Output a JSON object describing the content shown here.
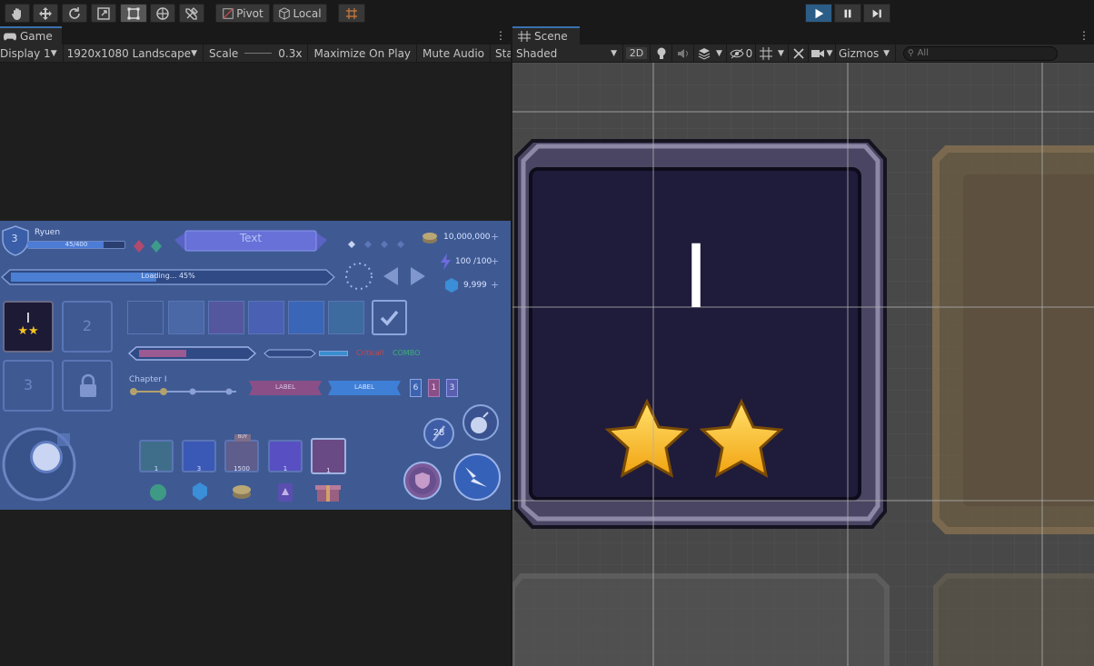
{
  "toolbar": {
    "tools": [
      {
        "name": "hand-tool-icon"
      },
      {
        "name": "move-tool-icon"
      },
      {
        "name": "rotate-tool-icon"
      },
      {
        "name": "scale-tool-icon"
      },
      {
        "name": "rect-tool-icon"
      },
      {
        "name": "transform-tool-icon"
      },
      {
        "name": "custom-tool-icon"
      }
    ],
    "pivot_label": "Pivot",
    "local_label": "Local",
    "grid_snap_icon": "grid-snap-icon"
  },
  "game_panel": {
    "tab_label": "Game",
    "display": "Display 1",
    "resolution": "1920x1080 Landscape",
    "scale_label": "Scale",
    "scale_value": "0.3x",
    "maximize": "Maximize On Play",
    "mute": "Mute Audio",
    "stats": "Sta",
    "ui": {
      "level": "3",
      "player_name": "Ryuen",
      "xp_text": "45/400",
      "banner_text": "Text",
      "coins": "10,000,000",
      "energy": "100 /100",
      "gems": "9,999",
      "loading": "Loading... 45%",
      "slot1": "I",
      "slot2": "2",
      "slot3": "3",
      "critical": "Critical!",
      "combo": "COMBO",
      "chapter": "Chapter I",
      "label1": "LABEL",
      "label2": "LABEL",
      "count_badges": [
        "6",
        "1",
        "3"
      ],
      "cooldown": "28",
      "item_counts": [
        "1",
        "3",
        "1500",
        "1",
        "1"
      ],
      "buy_tag": "BUY"
    }
  },
  "scene_panel": {
    "tab_label": "Scene",
    "shading": "Shaded",
    "mode_2d": "2D",
    "hidden_count": "0",
    "gizmos": "Gizmos",
    "search_placeholder": "All",
    "level_numeral": "I"
  },
  "colors": {
    "accent": "#3a72b0",
    "play_active": "#2c5d87",
    "game_canvas": "#3f5a93",
    "scene_bg": "#484848"
  }
}
